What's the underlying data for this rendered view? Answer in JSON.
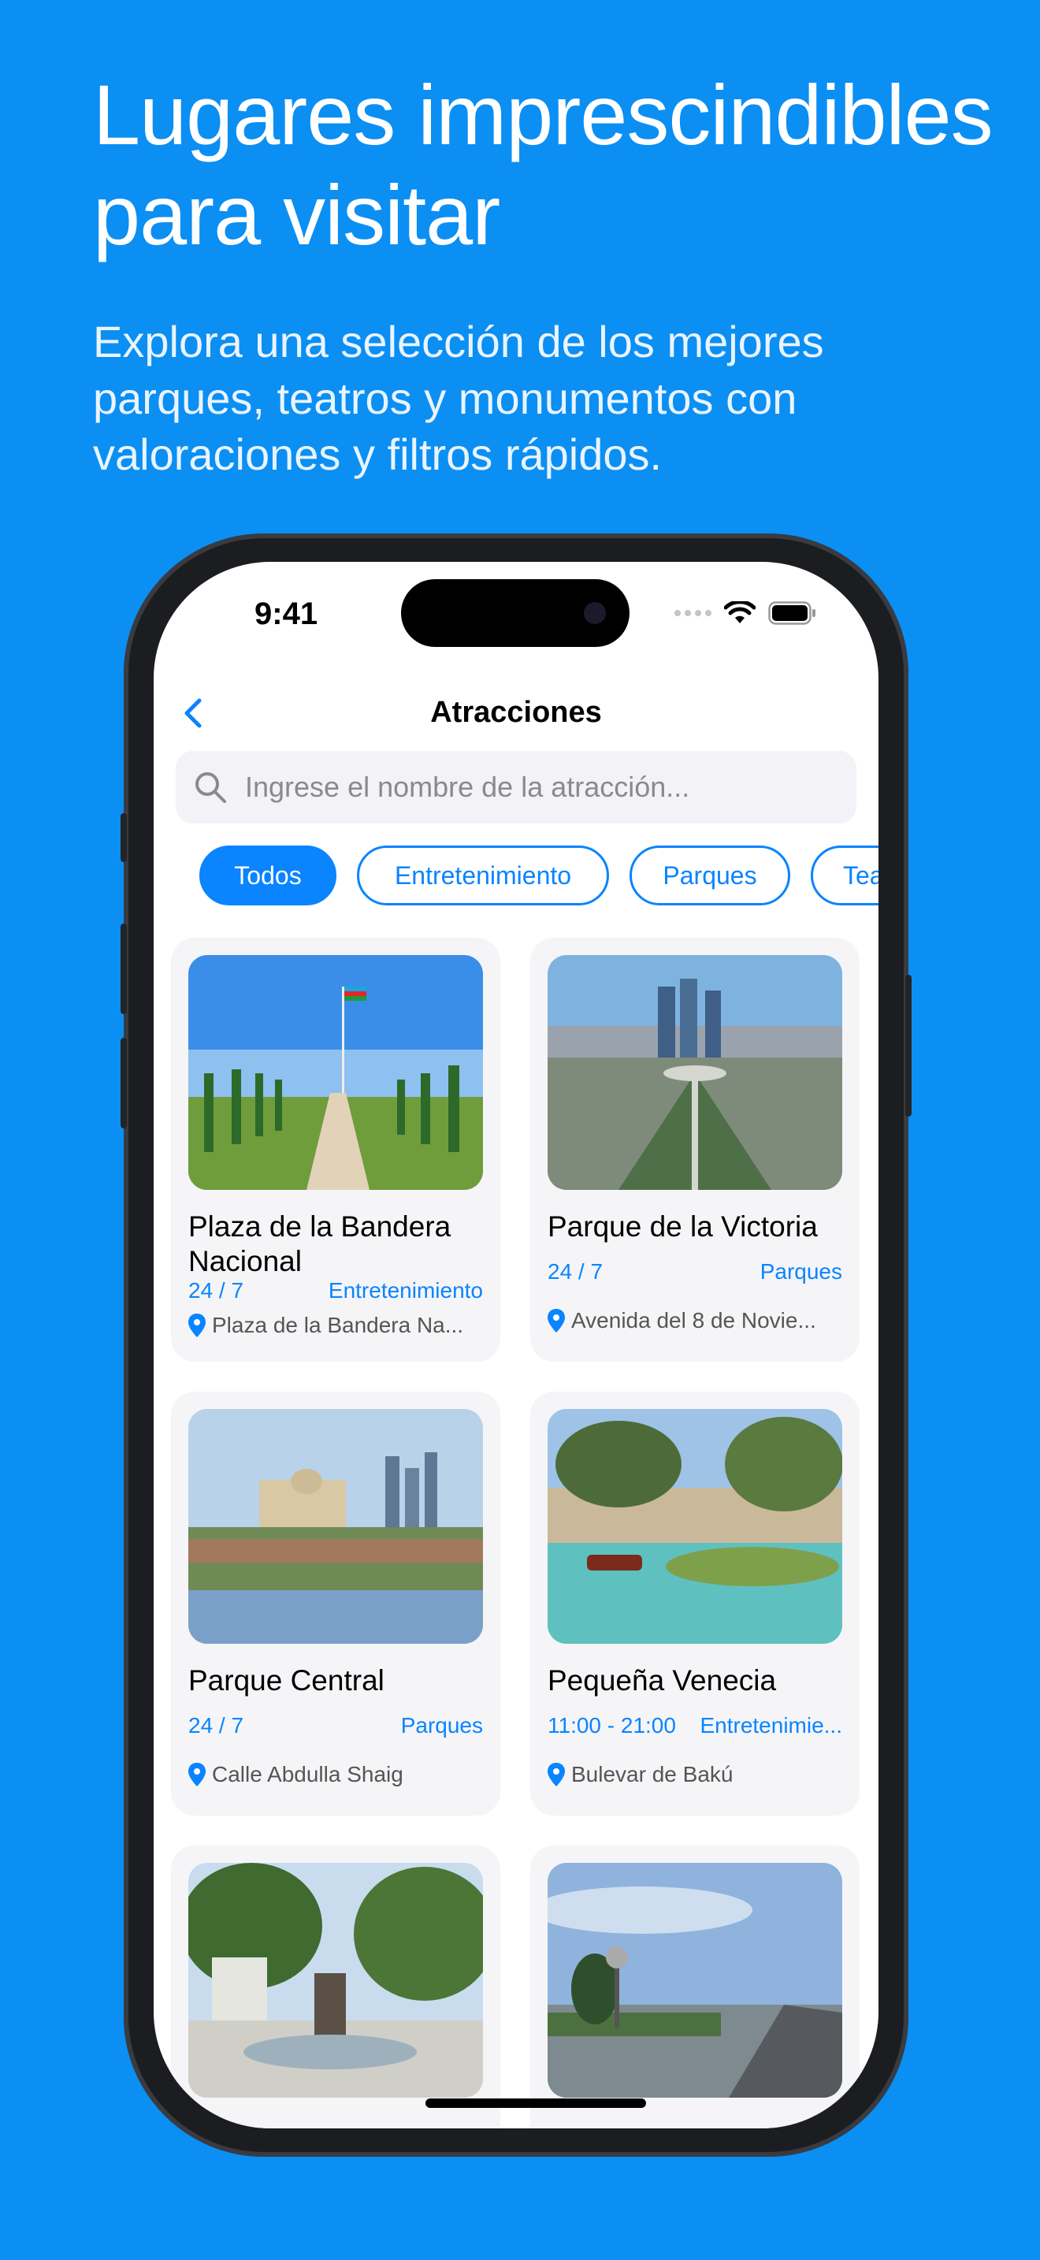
{
  "promo": {
    "headline": "Lugares imprescindibles para visitar",
    "subline": "Explora una selección de los mejores parques, teatros y monumentos con valoraciones y filtros rápidos."
  },
  "status_bar": {
    "time": "9:41"
  },
  "nav": {
    "title": "Atracciones"
  },
  "search": {
    "placeholder": "Ingrese el nombre de la atracción..."
  },
  "filters": [
    {
      "label": "Todos",
      "active": true
    },
    {
      "label": "Entretenimiento",
      "active": false
    },
    {
      "label": "Parques",
      "active": false
    },
    {
      "label": "Teat",
      "active": false
    }
  ],
  "attractions": [
    {
      "name": "Plaza de la Bandera Nacional",
      "hours": "24 / 7",
      "category": "Entretenimiento",
      "address": "Plaza de la Bandera Na..."
    },
    {
      "name": "Parque de la Victoria",
      "hours": "24 / 7",
      "category": "Parques",
      "address": "Avenida del 8 de Novie..."
    },
    {
      "name": "Parque Central",
      "hours": "24 / 7",
      "category": "Parques",
      "address": "Calle Abdulla Shaig"
    },
    {
      "name": "Pequeña Venecia",
      "hours": "11:00 - 21:00",
      "category": "Entretenimie...",
      "address": "Bulevar de Bakú"
    },
    {
      "name": "",
      "hours": "",
      "category": "",
      "address": ""
    },
    {
      "name": "",
      "hours": "",
      "category": "",
      "address": ""
    }
  ],
  "colors": {
    "background": "#0b8ff3",
    "accent": "#0a84ff",
    "card": "#f5f5f7"
  }
}
